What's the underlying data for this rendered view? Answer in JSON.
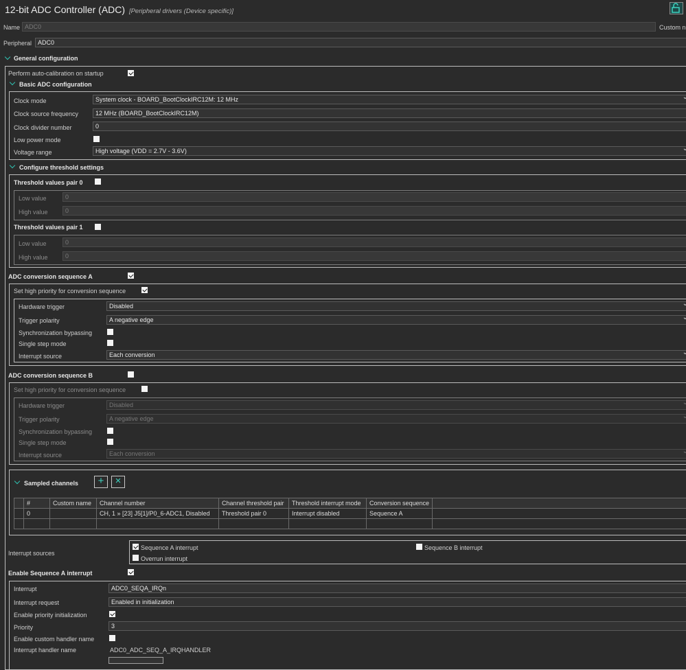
{
  "header": {
    "title": "12-bit ADC Controller (ADC)",
    "subtitle": "[Peripheral drivers (Device specific)]",
    "lock_icon": "unlock-icon"
  },
  "name": {
    "label": "Name",
    "value": "ADC0",
    "custom_label": "Custom n"
  },
  "peripheral": {
    "label": "Peripheral",
    "value": "ADC0"
  },
  "general": {
    "title": "General configuration",
    "autocal_label": "Perform auto-calibration on startup",
    "autocal_checked": true,
    "basic": {
      "title": "Basic ADC configuration",
      "clock_mode_label": "Clock mode",
      "clock_mode_value": "System clock - BOARD_BootClockIRC12M: 12 MHz",
      "clock_freq_label": "Clock source frequency",
      "clock_freq_value": "12 MHz (BOARD_BootClockIRC12M)",
      "clock_div_label": "Clock divider number",
      "clock_div_value": "0",
      "low_power_label": "Low power mode",
      "low_power_checked": false,
      "voltage_label": "Voltage range",
      "voltage_value": "High voltage (VDD = 2.7V - 3.6V)"
    },
    "threshold": {
      "title": "Configure threshold settings",
      "pair0_label": "Threshold values pair 0",
      "pair0_checked": false,
      "pair1_label": "Threshold values pair 1",
      "pair1_checked": false,
      "low_label": "Low value",
      "high_label": "High value",
      "pair0_low": "0",
      "pair0_high": "0",
      "pair1_low": "0",
      "pair1_high": "0"
    }
  },
  "seqA": {
    "label": "ADC conversion sequence A",
    "checked": true,
    "prio_label": "Set high priority for conversion sequence",
    "prio_checked": true,
    "hw_trigger_label": "Hardware trigger",
    "hw_trigger_value": "Disabled",
    "polarity_label": "Trigger polarity",
    "polarity_value": "A negative edge",
    "sync_label": "Synchronization bypassing",
    "sync_checked": false,
    "single_label": "Single step mode",
    "single_checked": false,
    "int_src_label": "Interrupt source",
    "int_src_value": "Each conversion"
  },
  "seqB": {
    "label": "ADC conversion sequence B",
    "checked": false,
    "prio_label": "Set high priority for conversion sequence",
    "prio_checked": false,
    "hw_trigger_label": "Hardware trigger",
    "hw_trigger_value": "Disabled",
    "polarity_label": "Trigger polarity",
    "polarity_value": "A negative edge",
    "sync_label": "Synchronization bypassing",
    "sync_checked": false,
    "single_label": "Single step mode",
    "single_checked": false,
    "int_src_label": "Interrupt source",
    "int_src_value": "Each conversion"
  },
  "channels": {
    "title": "Sampled channels",
    "add_icon": "plus-icon",
    "remove_icon": "close-icon",
    "headers": [
      "#",
      "Custom name",
      "Channel number",
      "Channel threshold pair",
      "Threshold interrupt mode",
      "Conversion sequence"
    ],
    "row": {
      "num": "0",
      "custom": "",
      "channel": "CH, 1 » [23] J5[1]/P0_6-ADC1, Disabled",
      "pair": "Threshold pair 0",
      "mode": "Interrupt disabled",
      "seq": "Sequence A"
    }
  },
  "interrupts": {
    "label": "Interrupt sources",
    "seqA_label": "Sequence A interrupt",
    "seqA_checked": true,
    "seqB_label": "Sequence B interrupt",
    "seqB_checked": false,
    "overrun_label": "Overrun interrupt",
    "overrun_checked": false
  },
  "seqAint": {
    "label": "Enable Sequence A interrupt",
    "checked": true,
    "interrupt_label": "Interrupt",
    "interrupt_value": "ADC0_SEQA_IRQn",
    "request_label": "Interrupt request",
    "request_value": "Enabled in initialization",
    "prio_init_label": "Enable priority initialization",
    "prio_init_checked": true,
    "priority_label": "Priority",
    "priority_value": "3",
    "custom_handler_label": "Enable custom handler name",
    "custom_handler_checked": false,
    "handler_label": "Interrupt handler name",
    "handler_value": "ADC0_ADC_SEQ_A_IRQHANDLER"
  }
}
